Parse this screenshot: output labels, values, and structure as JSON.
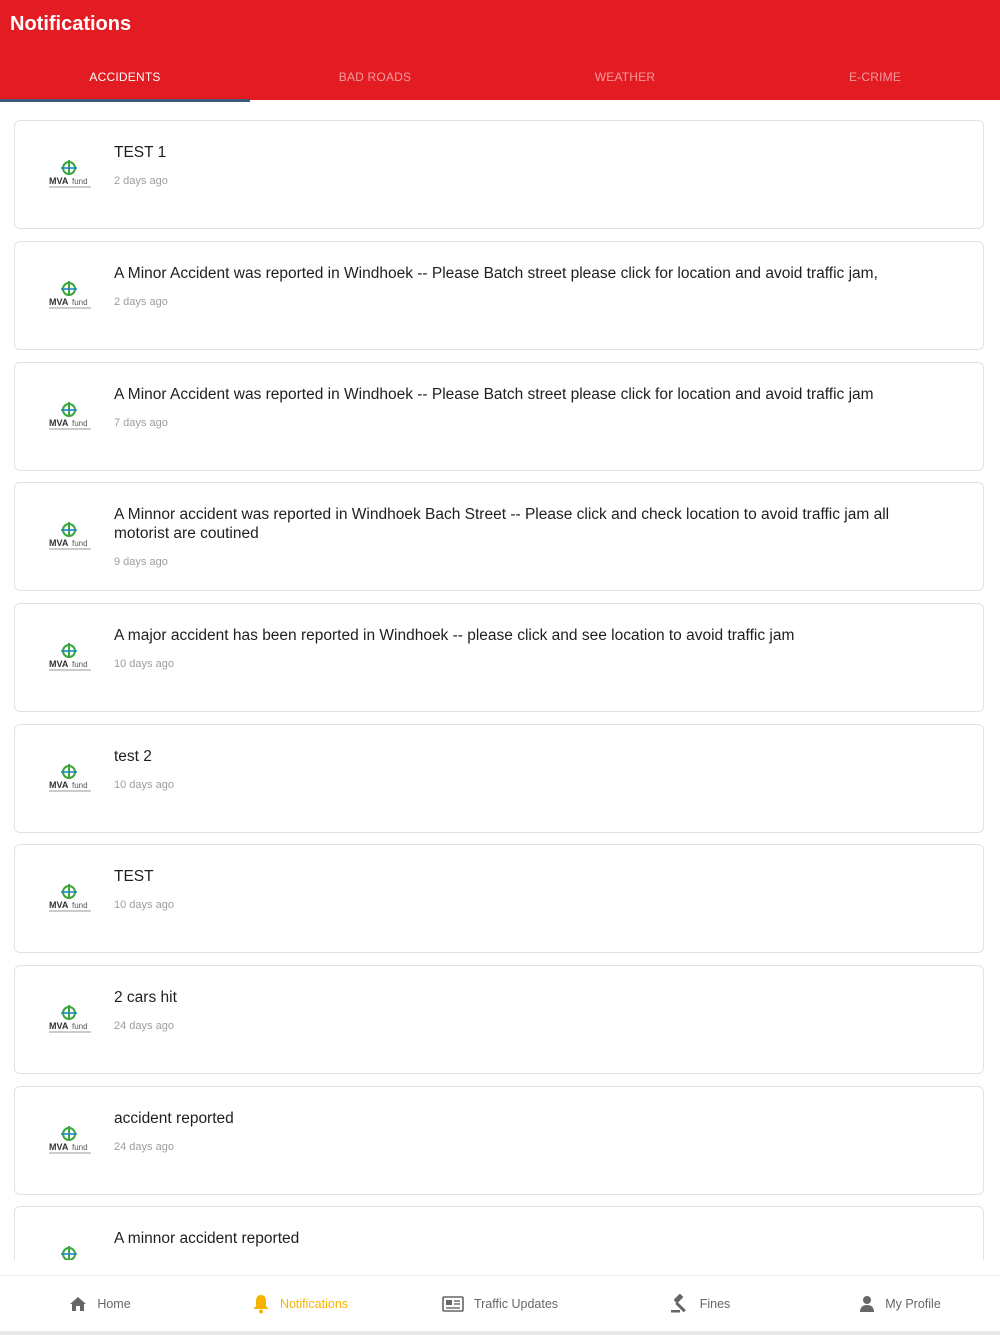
{
  "header": {
    "title": "Notifications"
  },
  "tabs": [
    {
      "label": "ACCIDENTS",
      "active": true
    },
    {
      "label": "BAD ROADS",
      "active": false
    },
    {
      "label": "WEATHER",
      "active": false
    },
    {
      "label": "E-CRIME",
      "active": false
    }
  ],
  "notifications": [
    {
      "title": "TEST 1",
      "time": "2 days ago"
    },
    {
      "title": "A Minor Accident was reported in Windhoek -- Please Batch street  please click for location and avoid traffic jam,",
      "time": "2 days ago"
    },
    {
      "title": "A Minor Accident was reported in Windhoek -- Please Batch street  please click for location and avoid traffic jam",
      "time": "7 days ago"
    },
    {
      "title": "A Minnor accident was reported in Windhoek Bach Street -- Please click and check location to avoid traffic jam all motorist are coutined",
      "time": "9 days ago"
    },
    {
      "title": "A major accident has been reported in Windhoek -- please click and see location to avoid traffic jam",
      "time": "10 days ago"
    },
    {
      "title": "test 2",
      "time": "10 days ago"
    },
    {
      "title": "TEST",
      "time": "10 days ago"
    },
    {
      "title": "2 cars hit",
      "time": "24 days ago"
    },
    {
      "title": "accident reported",
      "time": "24 days ago"
    },
    {
      "title": "A minnor accident reported",
      "time": ""
    }
  ],
  "bottom_nav": [
    {
      "label": "Home",
      "icon": "home-icon"
    },
    {
      "label": "Notifications",
      "icon": "bell-icon",
      "active": true
    },
    {
      "label": "Traffic Updates",
      "icon": "newspaper-icon"
    },
    {
      "label": "Fines",
      "icon": "gavel-icon"
    },
    {
      "label": "My Profile",
      "icon": "user-icon"
    }
  ],
  "colors": {
    "primary": "#e31b23",
    "tab_indicator": "#3f5a78",
    "nav_active": "#f6b400"
  }
}
